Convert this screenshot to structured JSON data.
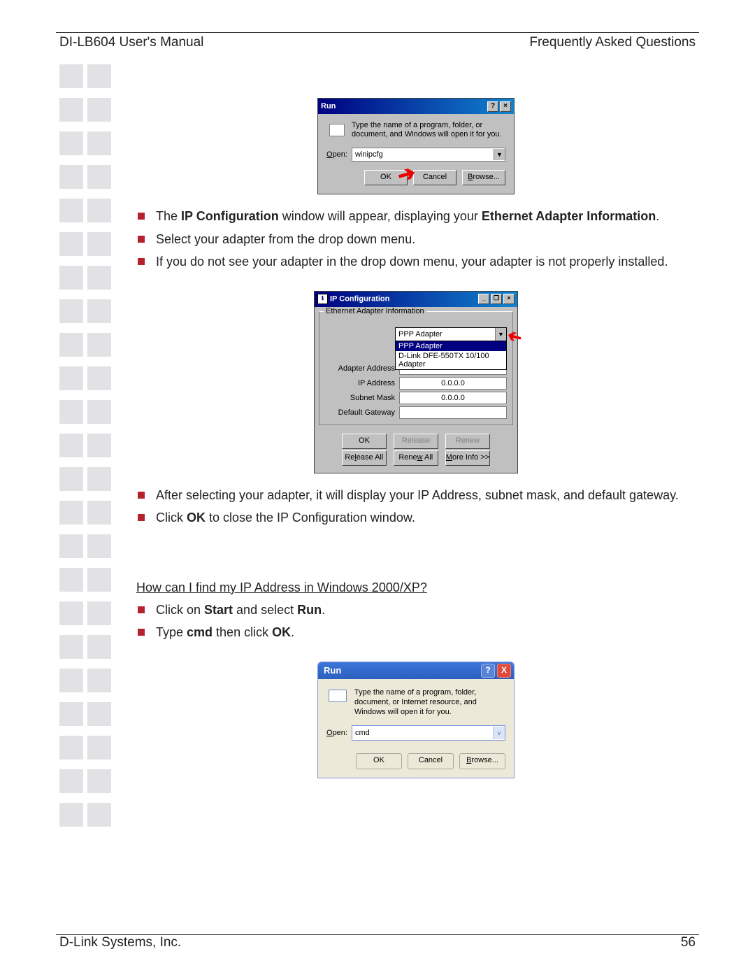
{
  "header": {
    "left": "DI-LB604 User's Manual",
    "right": "Frequently Asked Questions"
  },
  "footer": {
    "left": "D-Link Systems, Inc.",
    "page": "56"
  },
  "run98": {
    "title": "Run",
    "help": "?",
    "close": "×",
    "msg": "Type the name of a program, folder, or document, and Windows will open it for you.",
    "open_label": "Open:",
    "value": "winipcfg",
    "ok": "OK",
    "cancel": "Cancel",
    "browse": "Browse..."
  },
  "bullets1": {
    "a_pre": "The ",
    "a_b1": "IP Configuration",
    "a_mid": " window will appear, displaying your ",
    "a_b2": "Ethernet Adapter Information",
    "a_post": ".",
    "b": "Select your adapter from the drop down menu.",
    "c": "If you do not see your adapter in the drop down menu, your adapter is not properly installed."
  },
  "ipcfg": {
    "title": "IP Configuration",
    "min": "_",
    "restore": "❐",
    "close": "×",
    "group": "Ethernet Adapter Information",
    "selected": "PPP Adapter",
    "opt1": "PPP Adapter",
    "opt2": "D-Link DFE-550TX 10/100 Adapter",
    "lbl_addr": "Adapter Address",
    "lbl_ip": "IP Address",
    "val_ip": "0.0.0.0",
    "lbl_mask": "Subnet Mask",
    "val_mask": "0.0.0.0",
    "lbl_gw": "Default Gateway",
    "val_gw": "",
    "btn_ok": "OK",
    "btn_release": "Release",
    "btn_renew": "Renew",
    "btn_release_all": "Release All",
    "btn_renew_all": "Renew All",
    "btn_more": "More Info >>"
  },
  "bullets2": {
    "a": "After selecting your adapter, it will display your IP Address, subnet mask, and default gateway.",
    "b_pre": "Click ",
    "b_b": "OK",
    "b_post": " to close the IP Configuration window."
  },
  "q2": "How can I find my IP Address in Windows 2000/XP?",
  "bullets3": {
    "a_pre": "Click on ",
    "a_b1": "Start",
    "a_mid": " and select ",
    "a_b2": "Run",
    "a_post": ".",
    "b_pre": "Type ",
    "b_b1": "cmd",
    "b_mid": " then click ",
    "b_b2": "OK",
    "b_post": "."
  },
  "runxp": {
    "title": "Run",
    "help": "?",
    "close": "X",
    "msg": "Type the name of a program, folder, document, or Internet resource, and Windows will open it for you.",
    "open_label": "Open:",
    "value": "cmd",
    "ok": "OK",
    "cancel": "Cancel",
    "browse": "Browse..."
  }
}
